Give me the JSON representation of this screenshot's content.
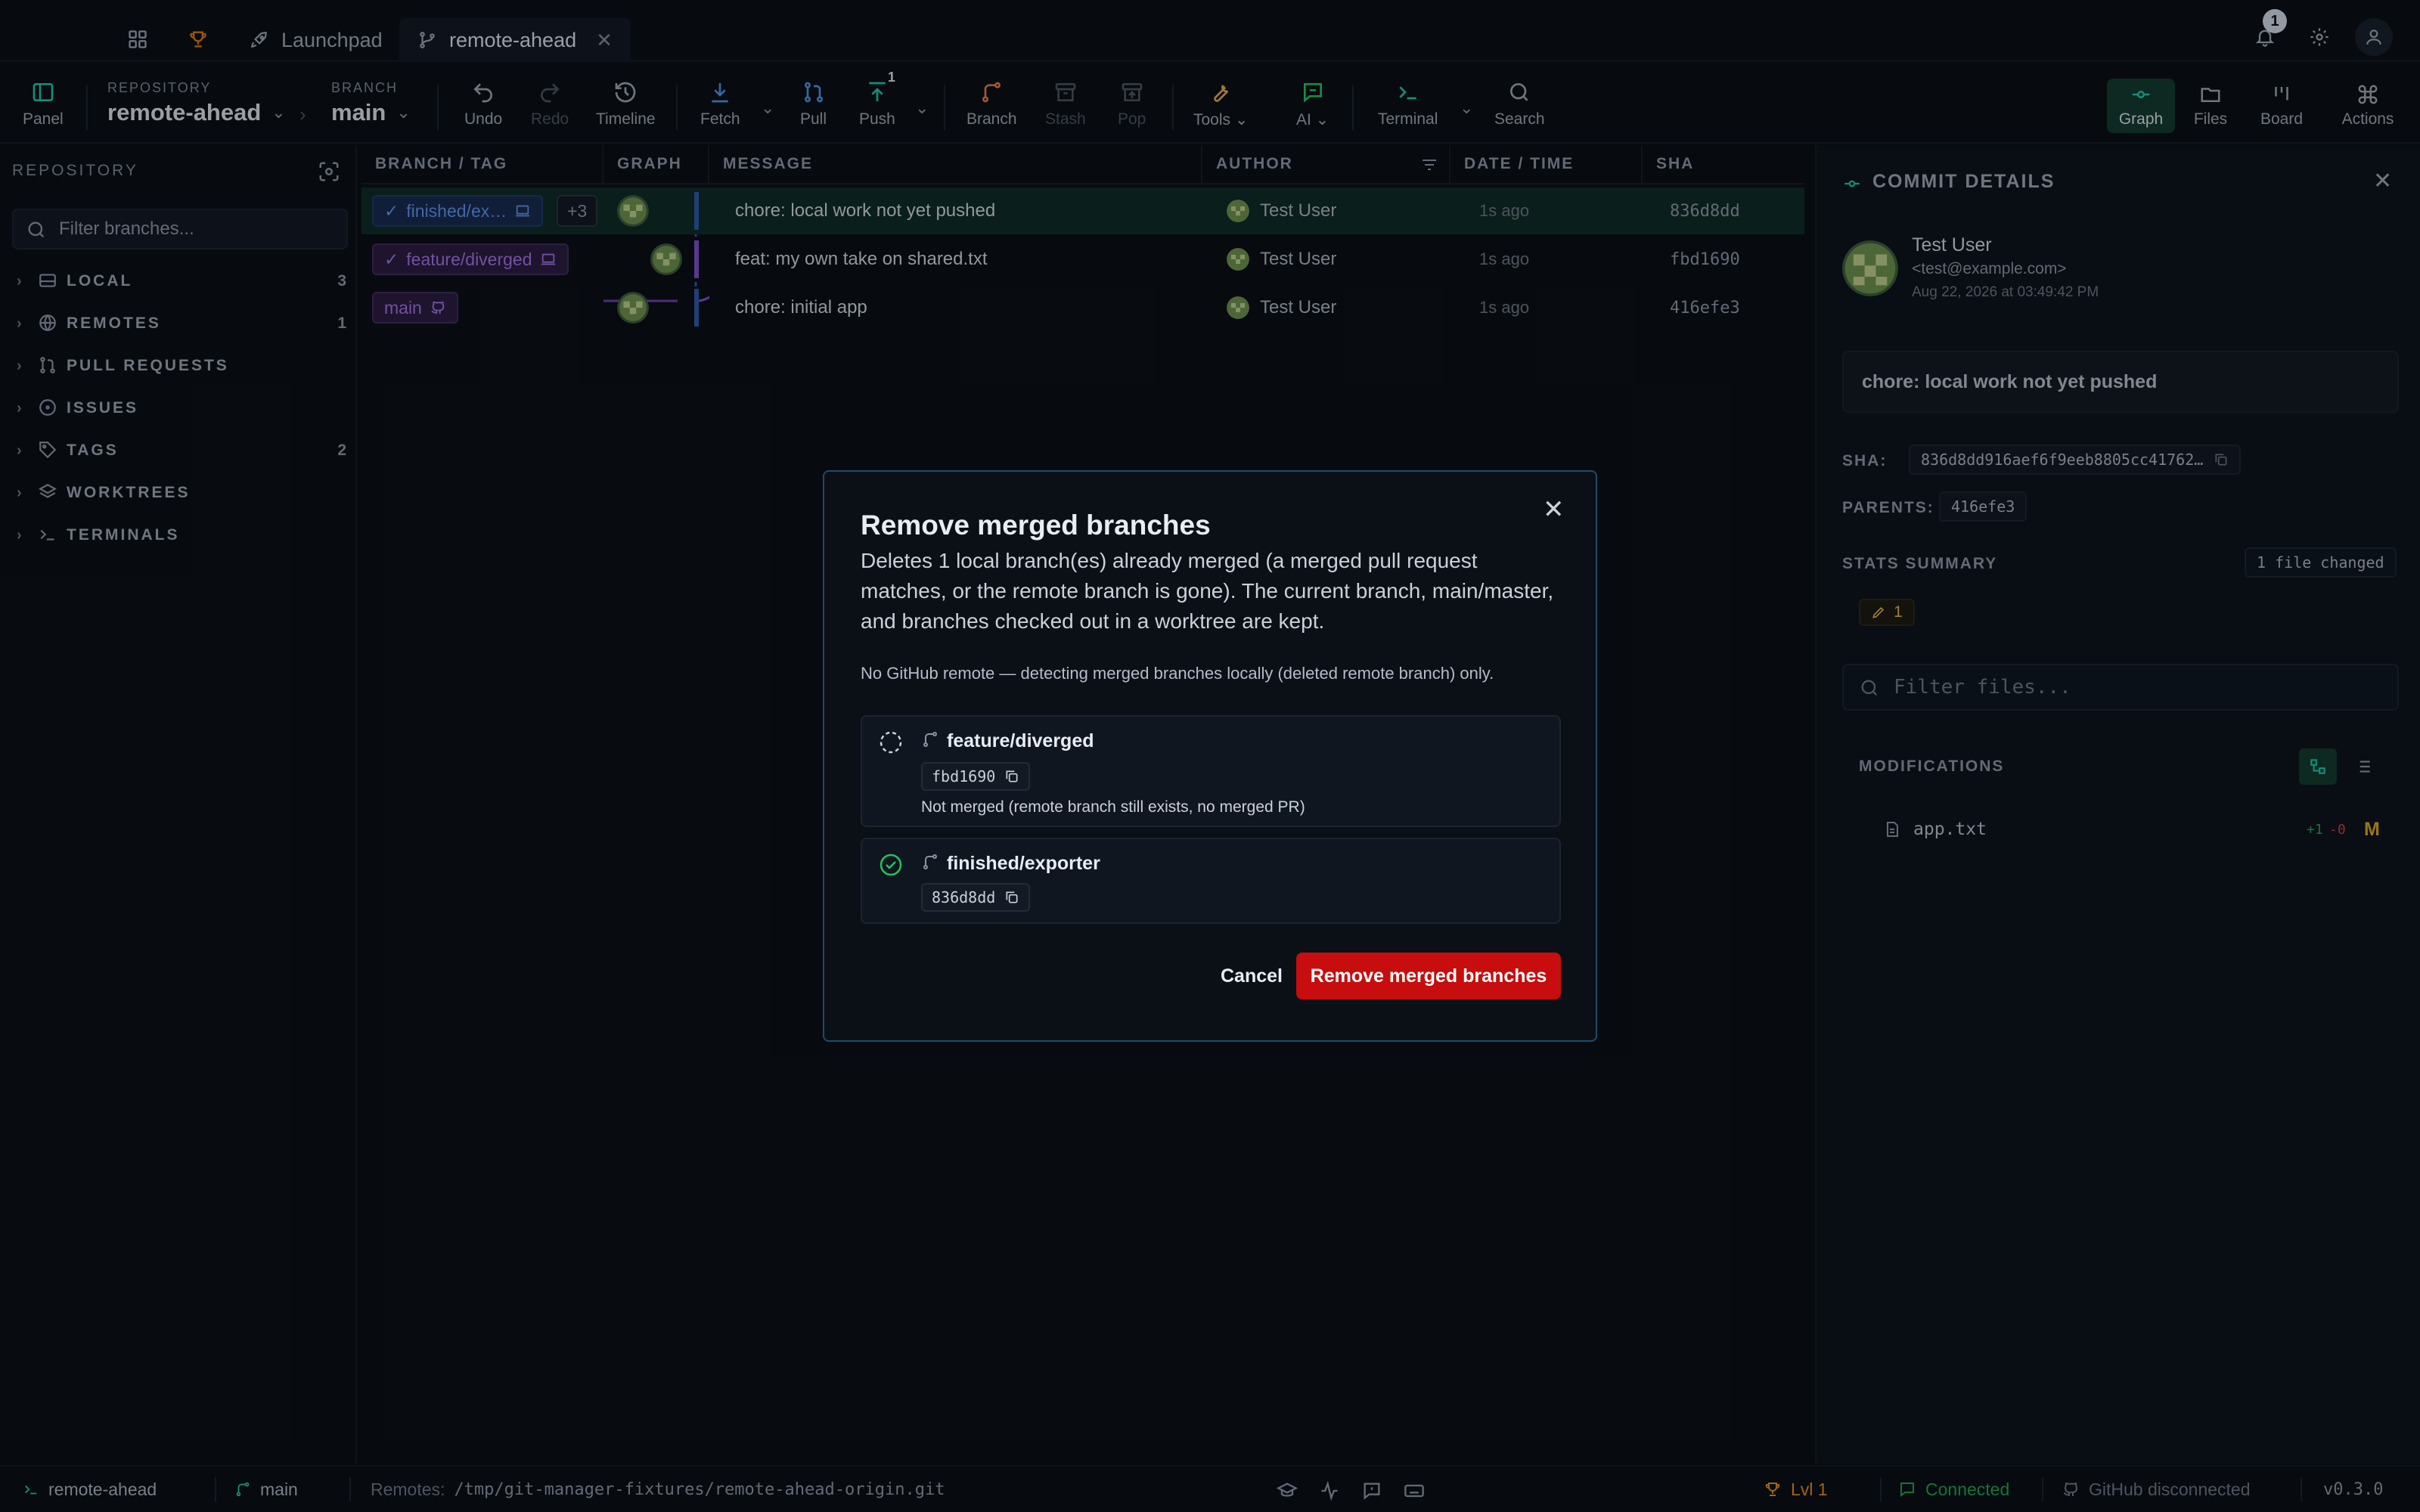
{
  "titlebar": {
    "tabs": [
      {
        "label": "Launchpad"
      },
      {
        "label": "remote-ahead"
      }
    ],
    "notification_count": "1"
  },
  "toolbar": {
    "panel": "Panel",
    "repository_label": "REPOSITORY",
    "repository_value": "remote-ahead",
    "branch_label": "BRANCH",
    "branch_value": "main",
    "undo": "Undo",
    "redo": "Redo",
    "timeline": "Timeline",
    "fetch": "Fetch",
    "pull": "Pull",
    "push": "Push",
    "push_badge": "1",
    "branch": "Branch",
    "stash": "Stash",
    "pop": "Pop",
    "tools": "Tools",
    "ai": "AI",
    "terminal": "Terminal",
    "search": "Search",
    "views": {
      "graph": "Graph",
      "files": "Files",
      "board": "Board",
      "actions": "Actions"
    }
  },
  "sidebar": {
    "heading": "REPOSITORY",
    "filter_placeholder": "Filter branches...",
    "items": [
      {
        "label": "LOCAL",
        "count": "3"
      },
      {
        "label": "REMOTES",
        "count": "1"
      },
      {
        "label": "PULL REQUESTS",
        "count": ""
      },
      {
        "label": "ISSUES",
        "count": ""
      },
      {
        "label": "TAGS",
        "count": "2"
      },
      {
        "label": "WORKTREES",
        "count": ""
      },
      {
        "label": "TERMINALS",
        "count": ""
      }
    ]
  },
  "table": {
    "headers": {
      "branch": "BRANCH / TAG",
      "graph": "GRAPH",
      "message": "MESSAGE",
      "author": "AUTHOR",
      "date": "DATE / TIME",
      "sha": "SHA"
    },
    "rows": [
      {
        "branch": "finished/ex…",
        "extra": "+3",
        "message": "chore: local work not yet pushed",
        "author": "Test User",
        "date": "1s ago",
        "sha": "836d8dd"
      },
      {
        "branch": "feature/diverged",
        "extra": "",
        "message": "feat: my own take on shared.txt",
        "author": "Test User",
        "date": "1s ago",
        "sha": "fbd1690"
      },
      {
        "branch": "main",
        "extra": "",
        "message": "chore: initial app",
        "author": "Test User",
        "date": "1s ago",
        "sha": "416efe3"
      }
    ]
  },
  "details": {
    "title": "COMMIT DETAILS",
    "author": "Test User",
    "email": "<test@example.com>",
    "date": "Aug 22, 2026 at 03:49:42 PM",
    "message": "chore: local work not yet pushed",
    "sha_label": "SHA:",
    "sha": "836d8dd916aef6f9eeb8805cc41762…",
    "parents_label": "PARENTS:",
    "parent": "416efe3",
    "stats_label": "STATS SUMMARY",
    "files_changed": "1 file changed",
    "modified_count": "1",
    "filter_placeholder": "Filter files...",
    "modifications_label": "MODIFICATIONS",
    "file": {
      "name": "app.txt",
      "additions": "+1",
      "deletions": "-0",
      "status": "M"
    }
  },
  "dialog": {
    "title": "Remove merged branches",
    "description": "Deletes 1 local branch(es) already merged (a merged pull request matches, or the remote branch is gone). The current branch, main/master, and branches checked out in a worktree are kept.",
    "note": "No GitHub remote — detecting merged branches locally (deleted remote branch) only.",
    "branches": [
      {
        "name": "feature/diverged",
        "sha": "fbd1690",
        "reason": "Not merged (remote branch still exists, no merged PR)"
      },
      {
        "name": "finished/exporter",
        "sha": "836d8dd",
        "reason": ""
      }
    ],
    "cancel": "Cancel",
    "confirm": "Remove merged branches"
  },
  "statusbar": {
    "repo": "remote-ahead",
    "branch": "main",
    "remotes_label": "Remotes:",
    "remotes_path": "/tmp/git-manager-fixtures/remote-ahead-origin.git",
    "level": "Lvl 1",
    "connection": "Connected",
    "github": "GitHub disconnected",
    "version": "v0.3.0"
  },
  "colors": {
    "accent": "#22c3a6",
    "danger": "#c70d0d",
    "branch_blue": "#5f8fe8",
    "branch_purple": "#9b72e0"
  }
}
